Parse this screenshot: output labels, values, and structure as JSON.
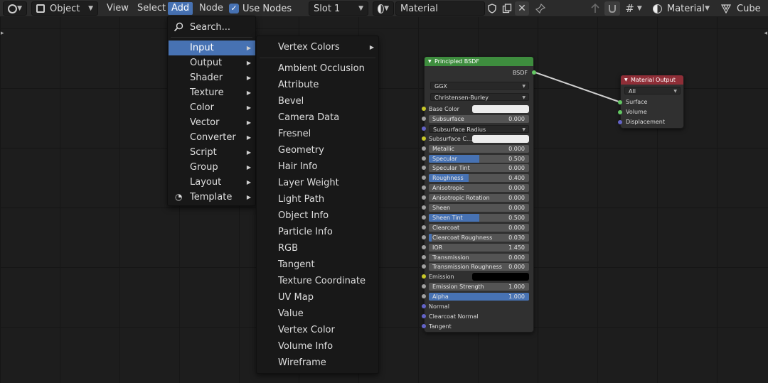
{
  "header": {
    "mode": "Object",
    "menus": [
      "View",
      "Select",
      "Add",
      "Node"
    ],
    "use_nodes_label": "Use Nodes",
    "slot": "Slot 1",
    "material_name": "Material",
    "render_mode": "Material",
    "object_name": "Cube"
  },
  "add_menu": {
    "search": "Search...",
    "items": [
      "Input",
      "Output",
      "Shader",
      "Texture",
      "Color",
      "Vector",
      "Converter",
      "Script",
      "Group",
      "Layout",
      "Template"
    ]
  },
  "input_menu": {
    "items": [
      "Vertex Colors",
      "Ambient Occlusion",
      "Attribute",
      "Bevel",
      "Camera Data",
      "Fresnel",
      "Geometry",
      "Hair Info",
      "Layer Weight",
      "Light Path",
      "Object Info",
      "Particle Info",
      "RGB",
      "Tangent",
      "Texture Coordinate",
      "UV Map",
      "Value",
      "Vertex Color",
      "Volume Info",
      "Wireframe"
    ]
  },
  "bsdf_node": {
    "title": "Principled BSDF",
    "output": "BSDF",
    "distribution": "GGX",
    "subsurface_method": "Christensen-Burley",
    "base_color_label": "Base Color",
    "subsurface_color_label": "Subsurface C...",
    "subsurface_radius_label": "Subsurface Radius",
    "emission_label": "Emission",
    "normal_label": "Normal",
    "clearcoat_normal_label": "Clearcoat Normal",
    "tangent_label": "Tangent",
    "colors": {
      "base": "#ececec",
      "subsurface": "#ececec",
      "emission": "#000000"
    },
    "fields": [
      {
        "label": "Subsurface",
        "value": "0.000",
        "fraction": 0
      },
      {
        "label": "Metallic",
        "value": "0.000",
        "fraction": 0
      },
      {
        "label": "Specular",
        "value": "0.500",
        "fraction": 0.5
      },
      {
        "label": "Specular Tint",
        "value": "0.000",
        "fraction": 0
      },
      {
        "label": "Roughness",
        "value": "0.400",
        "fraction": 0.4
      },
      {
        "label": "Anisotropic",
        "value": "0.000",
        "fraction": 0
      },
      {
        "label": "Anisotropic Rotation",
        "value": "0.000",
        "fraction": 0
      },
      {
        "label": "Sheen",
        "value": "0.000",
        "fraction": 0
      },
      {
        "label": "Sheen Tint",
        "value": "0.500",
        "fraction": 0.5
      },
      {
        "label": "Clearcoat",
        "value": "0.000",
        "fraction": 0
      },
      {
        "label": "Clearcoat Roughness",
        "value": "0.030",
        "fraction": 0.03
      },
      {
        "label": "IOR",
        "value": "1.450",
        "fraction": 0
      },
      {
        "label": "Transmission",
        "value": "0.000",
        "fraction": 0
      },
      {
        "label": "Transmission Roughness",
        "value": "0.000",
        "fraction": 0
      },
      {
        "label": "Emission Strength",
        "value": "1.000",
        "fraction": 0
      },
      {
        "label": "Alpha",
        "value": "1.000",
        "fraction": 1
      }
    ]
  },
  "output_node": {
    "title": "Material Output",
    "target": "All",
    "inputs": [
      "Surface",
      "Volume",
      "Displacement"
    ]
  },
  "colors": {
    "accent": "#4772b3",
    "shader_header": "#3e8d3e",
    "output_header": "#8f2e37",
    "socket_color": "#c7c729",
    "socket_float": "#a1a1a1",
    "socket_vector": "#6363c7",
    "socket_shader": "#63c763"
  }
}
